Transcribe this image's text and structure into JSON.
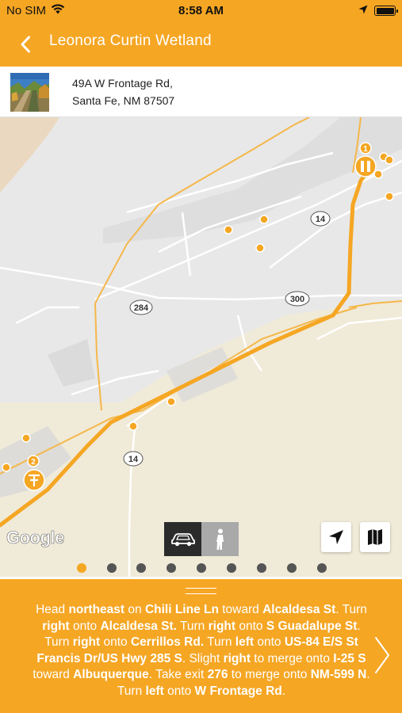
{
  "status_bar": {
    "carrier": "No SIM",
    "time": "8:58 AM",
    "icons": [
      "wifi-icon",
      "location-arrow-icon",
      "battery-icon"
    ]
  },
  "nav": {
    "title": "Leonora Curtin Wetland",
    "back_icon": "chevron-left-icon"
  },
  "location": {
    "address_line1": "49A W Frontage Rd,",
    "address_line2": "Santa Fe, NM 87507",
    "thumbnail": "wetland-photo"
  },
  "map": {
    "road_labels": [
      "14",
      "284",
      "300",
      "14"
    ],
    "markers": [
      "1",
      "2"
    ],
    "attribution": "Google",
    "travel_modes": [
      {
        "name": "car-mode",
        "selected": true
      },
      {
        "name": "walk-mode",
        "selected": false
      }
    ],
    "controls": [
      "current-location-button",
      "map-view-button"
    ]
  },
  "pager": {
    "count": 9,
    "active_index": 0
  },
  "directions": {
    "segments": [
      {
        "text": "Head ",
        "b": false
      },
      {
        "text": "northeast",
        "b": true
      },
      {
        "text": " on ",
        "b": false
      },
      {
        "text": "Chili Line Ln",
        "b": true
      },
      {
        "text": " toward ",
        "b": false
      },
      {
        "text": "Alcaldesa St",
        "b": true
      },
      {
        "text": ". Turn ",
        "b": false
      },
      {
        "text": "right",
        "b": true
      },
      {
        "text": " onto ",
        "b": false
      },
      {
        "text": "Alcaldesa St.",
        "b": true
      },
      {
        "text": " Turn ",
        "b": false
      },
      {
        "text": "right",
        "b": true
      },
      {
        "text": " onto ",
        "b": false
      },
      {
        "text": "S Guadalupe St",
        "b": true
      },
      {
        "text": ". Turn ",
        "b": false
      },
      {
        "text": "right",
        "b": true
      },
      {
        "text": " onto ",
        "b": false
      },
      {
        "text": "Cerrillos Rd.",
        "b": true
      },
      {
        "text": " Turn ",
        "b": false
      },
      {
        "text": "left",
        "b": true
      },
      {
        "text": " onto ",
        "b": false
      },
      {
        "text": "US-84 E/S St Francis Dr/US Hwy 285 S",
        "b": true
      },
      {
        "text": ". Slight ",
        "b": false
      },
      {
        "text": "right",
        "b": true
      },
      {
        "text": " to merge onto ",
        "b": false
      },
      {
        "text": "I-25 S",
        "b": true
      },
      {
        "text": " toward ",
        "b": false
      },
      {
        "text": "Albuquerque",
        "b": true
      },
      {
        "text": ". Take exit ",
        "b": false
      },
      {
        "text": "276",
        "b": true
      },
      {
        "text": " to merge onto ",
        "b": false
      },
      {
        "text": "NM-599 N",
        "b": true
      },
      {
        "text": ". Turn ",
        "b": false
      },
      {
        "text": "left",
        "b": true
      },
      {
        "text": " onto ",
        "b": false
      },
      {
        "text": "W Frontage Rd",
        "b": true
      },
      {
        "text": ".",
        "b": false
      }
    ],
    "next_icon": "chevron-right-icon"
  },
  "colors": {
    "accent": "#f5a623",
    "route": "#f5a623",
    "map_background": "#e8e8e8"
  }
}
